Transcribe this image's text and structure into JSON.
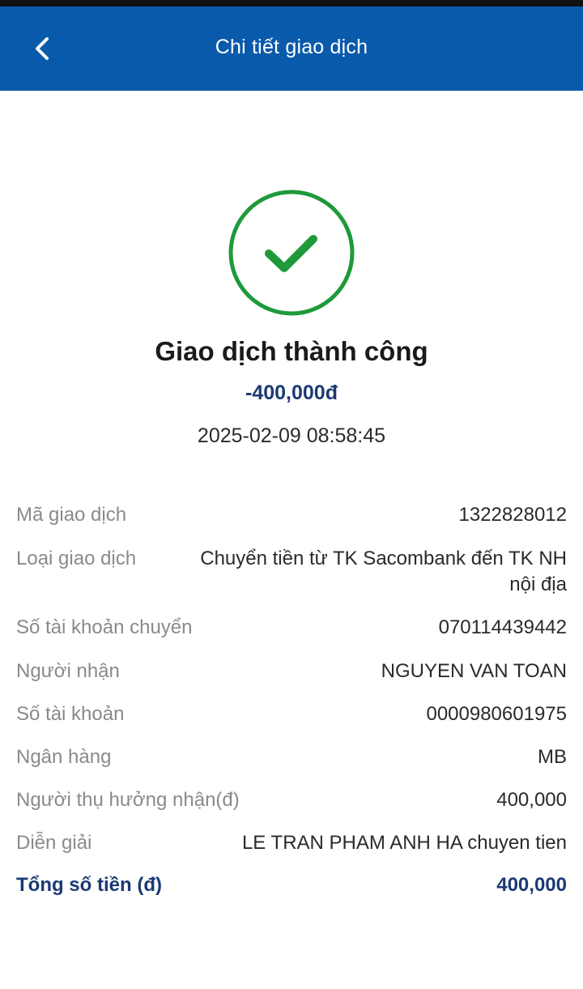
{
  "header": {
    "title": "Chi tiết giao dịch"
  },
  "status": {
    "title": "Giao dịch thành công",
    "amount": "-400,000đ",
    "datetime": "2025-02-09 08:58:45",
    "color": "#1e9a3a"
  },
  "details": {
    "rows": [
      {
        "label": "Mã giao dịch",
        "value": "1322828012"
      },
      {
        "label": "Loại giao dịch",
        "value": "Chuyển tiền từ TK Sacombank đến TK NH nội địa"
      },
      {
        "label": "Số tài khoản chuyển",
        "value": "070114439442"
      },
      {
        "label": "Người nhận",
        "value": "NGUYEN VAN TOAN"
      },
      {
        "label": "Số tài khoản",
        "value": "0000980601975"
      },
      {
        "label": "Ngân hàng",
        "value": "MB"
      },
      {
        "label": "Người thụ hưởng nhận(đ)",
        "value": "400,000"
      },
      {
        "label": "Diễn giải",
        "value": "LE TRAN PHAM ANH HA chuyen tien"
      }
    ],
    "total": {
      "label": "Tổng số tiền (đ)",
      "value": "400,000"
    }
  },
  "colors": {
    "header_bg": "#0a5aab",
    "accent_text": "#1b3a73",
    "success": "#1e9a3a"
  }
}
